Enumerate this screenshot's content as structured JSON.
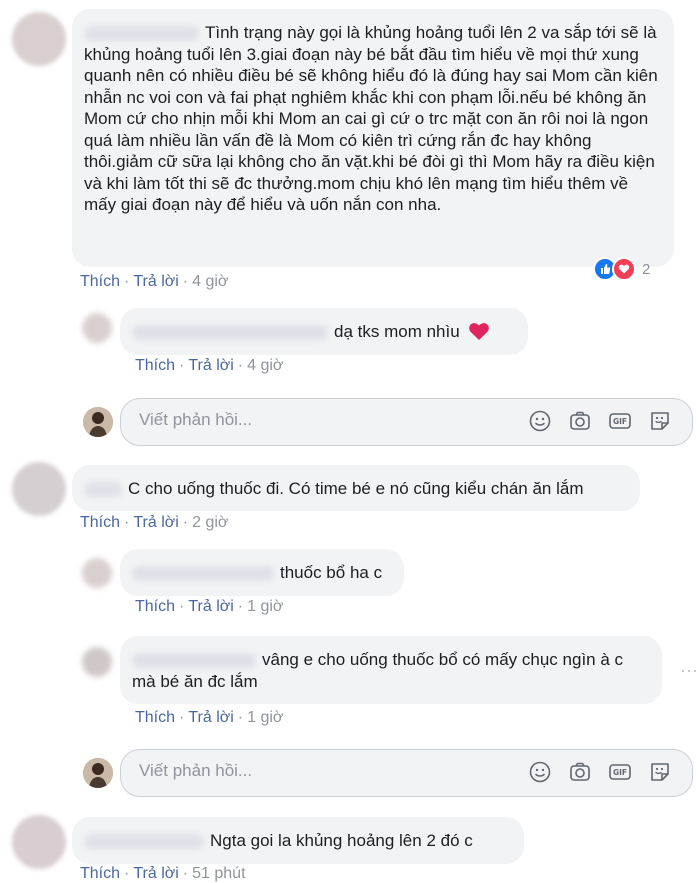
{
  "comment1": {
    "text": "Tình trạng này gọi là khủng hoảng tuổi lên 2 va sắp tới sẽ là khủng hoảng tuổi lên 3.giai đoạn này bé bắt đầu tìm hiểu về mọi thứ xung quanh nên có nhiều điều bé sẽ không hiểu đó là đúng hay sai Mom cần kiên nhẫn nc voi con và fai phạt nghiêm khắc khi con phạm lỗi.nếu bé không ăn Mom cứ cho nhịn mỗi khi Mom an cai gì cứ o trc mặt con ăn rôi noi là ngon quá làm nhiều lần vấn đề là Mom có kiên trì cứng rắn đc hay không thôi.giảm cữ sữa lại không cho ăn vặt.khi bé đòi gì thì Mom hãy ra điều kiện và khi làm tốt thi sẽ đc thưởng.mom chịu khó lên mạng tìm hiểu thêm về mấy giai đoạn này để hiểu và uốn nắn con nha.",
    "like": "Thích",
    "reply": "Trả lời",
    "time": "4 giờ",
    "reaction_count": "2"
  },
  "reply1": {
    "text": "dạ tks mom nhìu",
    "like": "Thích",
    "reply": "Trả lời",
    "time": "4 giờ"
  },
  "reply_box": {
    "placeholder": "Viết phản hồi..."
  },
  "comment2": {
    "text": "C cho uống thuốc đi. Có time bé e nó cũng kiểu chán ăn lắm",
    "like": "Thích",
    "reply": "Trả lời",
    "time": "2 giờ"
  },
  "reply2": {
    "text": "thuốc bổ ha c",
    "like": "Thích",
    "reply": "Trả lời",
    "time": "1 giờ"
  },
  "reply3": {
    "text": "vâng e cho uống thuốc bổ có mấy chục ngìn à c mà bé ăn đc lắm",
    "like": "Thích",
    "reply": "Trả lời",
    "time": "1 giờ"
  },
  "comment3": {
    "text": "Ngta goi la khủng hoảng lên 2 đó c",
    "like": "Thích",
    "reply": "Trả lời",
    "time": "51 phút"
  },
  "icons": [
    "emoji-icon",
    "camera-icon",
    "gif-icon",
    "sticker-icon"
  ],
  "colors": {
    "link": "#4b67a1",
    "meta": "#90949c",
    "bubble": "#f2f3f5",
    "like_blue": "#1877f2",
    "love_red": "#f33e58"
  }
}
